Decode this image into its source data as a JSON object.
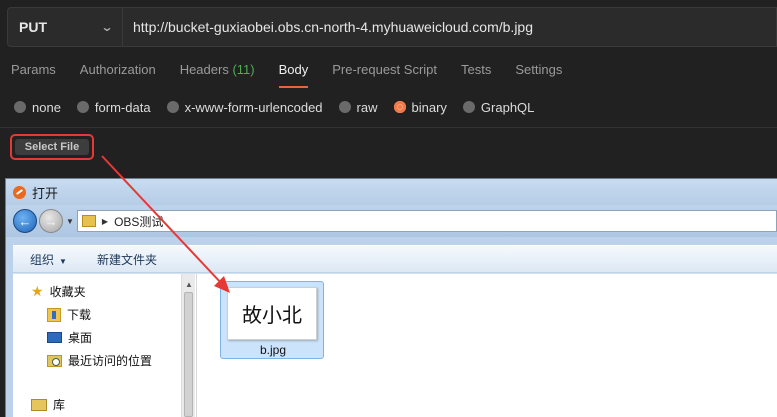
{
  "request": {
    "method": "PUT",
    "url": "http://bucket-guxiaobei.obs.cn-north-4.myhuaweicloud.com/b.jpg"
  },
  "tabs": [
    {
      "label": "Params"
    },
    {
      "label": "Authorization"
    },
    {
      "label": "Headers",
      "count": "(11)"
    },
    {
      "label": "Body",
      "active": true
    },
    {
      "label": "Pre-request Script"
    },
    {
      "label": "Tests"
    },
    {
      "label": "Settings"
    }
  ],
  "body_types": [
    {
      "label": "none"
    },
    {
      "label": "form-data"
    },
    {
      "label": "x-www-form-urlencoded"
    },
    {
      "label": "raw"
    },
    {
      "label": "binary",
      "checked": true
    },
    {
      "label": "GraphQL"
    }
  ],
  "select_file_label": "Select File",
  "dialog": {
    "title": "打开",
    "address": "OBS测试",
    "toolbar": {
      "organize": "组织",
      "new_folder": "新建文件夹"
    },
    "nav": {
      "favorites": "收藏夹",
      "downloads": "下载",
      "desktop": "桌面",
      "recent": "最近访问的位置",
      "libraries": "库"
    },
    "file": {
      "name": "b.jpg",
      "thumbnail_text": "故小北"
    }
  },
  "colors": {
    "accent": "#e8643b",
    "annotation": "#e53935",
    "headers_count": "#4caf50"
  }
}
